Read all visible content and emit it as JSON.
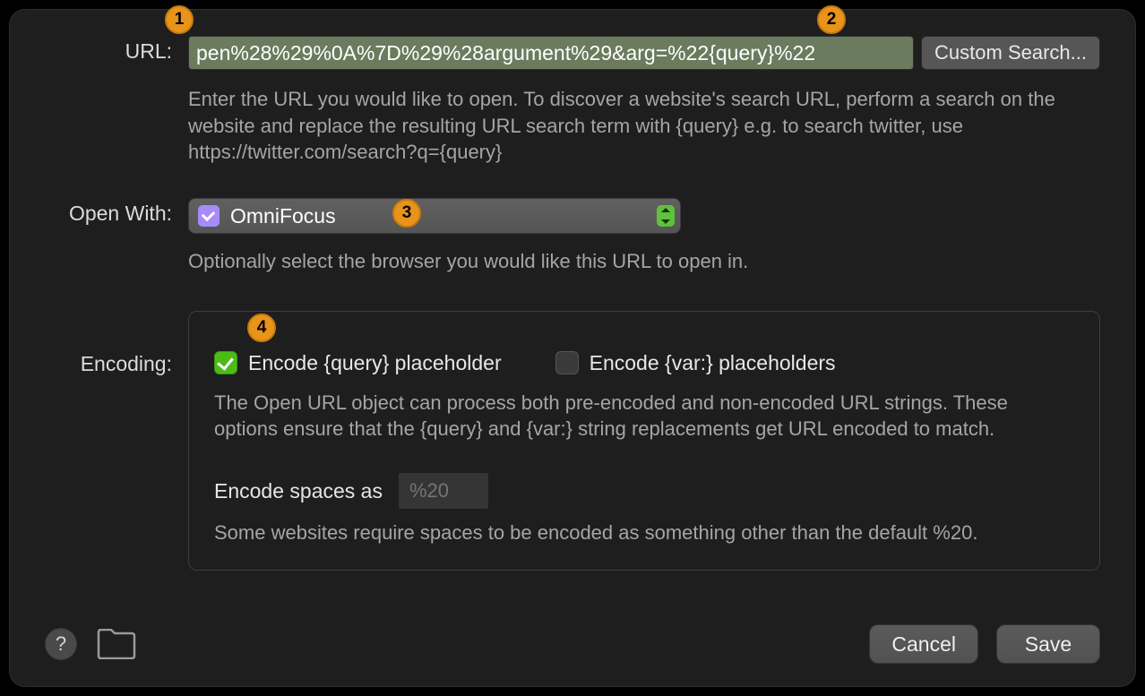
{
  "labels": {
    "url": "URL:",
    "open_with": "Open With:",
    "encoding": "Encoding:"
  },
  "url": {
    "value": "pen%28%29%0A%7D%29%28argument%29&arg=%22{query}%22",
    "custom_search": "Custom Search...",
    "help": "Enter the URL you would like to open. To discover a website's search URL, perform a search on the website and replace the resulting URL search term with {query} e.g. to search twitter, use https://twitter.com/search?q={query}"
  },
  "open_with": {
    "app": "OmniFocus",
    "help": "Optionally select the browser you would like this URL to open in."
  },
  "encoding": {
    "query_label": "Encode {query} placeholder",
    "var_label": "Encode {var:} placeholders",
    "help": "The Open URL object can process both pre-encoded and non-encoded URL strings. These options ensure that the {query} and {var:} string replacements get URL encoded to match.",
    "spaces_label": "Encode spaces as",
    "spaces_placeholder": "%20",
    "spaces_help": "Some websites require spaces to be encoded as something other than the default %20."
  },
  "footer": {
    "help": "?",
    "cancel": "Cancel",
    "save": "Save"
  },
  "callouts": {
    "c1": "1",
    "c2": "2",
    "c3": "3",
    "c4": "4"
  }
}
